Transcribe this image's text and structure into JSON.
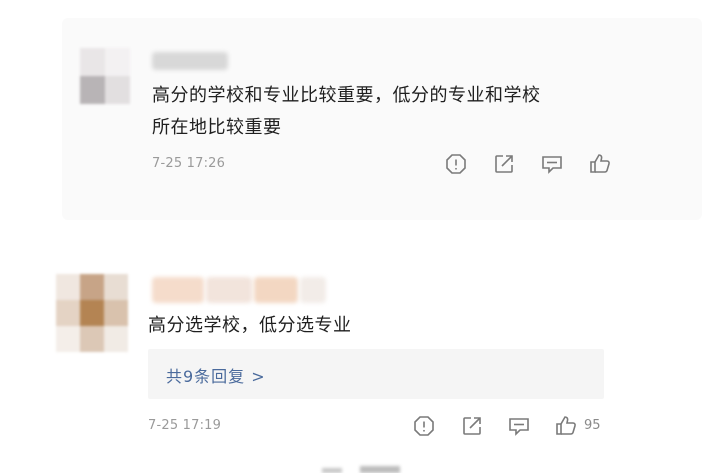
{
  "comments": [
    {
      "text_lines": [
        "高分的学校和专业比较重要，低分的专业和学校",
        "所在地比较重要"
      ],
      "timestamp": "7-25 17:26"
    },
    {
      "text_lines": [
        "高分选学校，低分选专业"
      ],
      "replies_label": "共9条回复 >",
      "timestamp": "7-25 17:19",
      "likes": "95"
    }
  ],
  "icons": [
    "report-icon",
    "share-icon",
    "reply-icon",
    "like-icon"
  ],
  "colors": {
    "card_background": "#fafafa",
    "timestamp": "#9a9a9a",
    "replies_link": "#4a6a9c",
    "replies_background": "#f5f5f5",
    "icon": "#7a7a7a"
  }
}
